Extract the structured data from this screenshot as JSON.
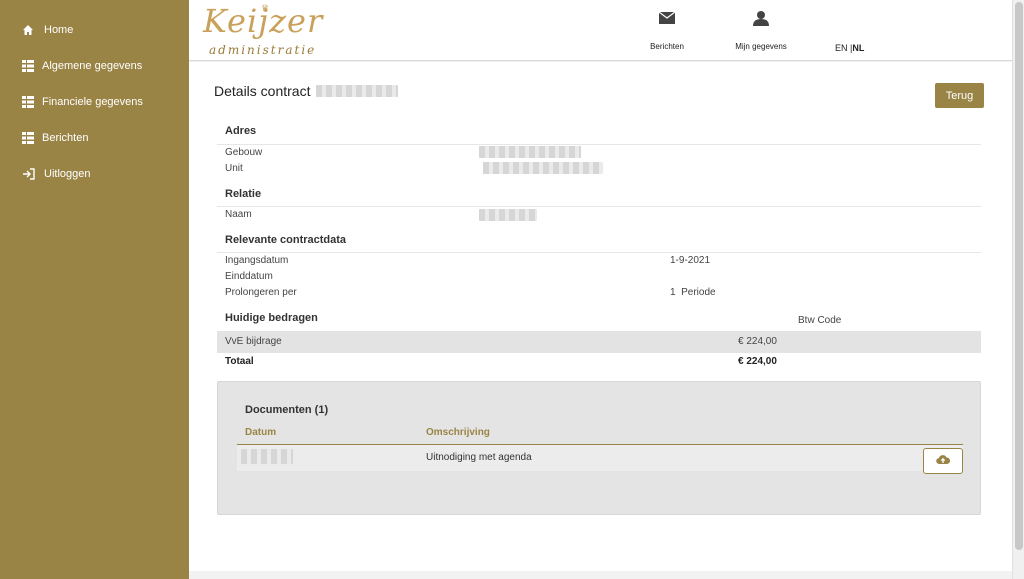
{
  "sidebar": {
    "items": [
      {
        "label": "Home",
        "icon": "home-icon"
      },
      {
        "label": "Algemene gegevens",
        "icon": "list-icon"
      },
      {
        "label": "Financiele gegevens",
        "icon": "list-icon"
      },
      {
        "label": "Berichten",
        "icon": "list-icon"
      },
      {
        "label": "Uitloggen",
        "icon": "logout-icon"
      }
    ]
  },
  "header": {
    "logo_main": "Keijzer",
    "logo_sub": "administratie",
    "messages_label": "Berichten",
    "profile_label": "Mijn gegevens",
    "lang_en": "EN",
    "lang_sep": " |",
    "lang_nl": "NL"
  },
  "page": {
    "title": "Details contract",
    "back_button": "Terug"
  },
  "sections": {
    "adres": {
      "title": "Adres",
      "gebouw_label": "Gebouw",
      "unit_label": "Unit"
    },
    "relatie": {
      "title": "Relatie",
      "naam_label": "Naam"
    },
    "contract": {
      "title": "Relevante contractdata",
      "ingangsdatum_label": "Ingangsdatum",
      "ingangsdatum_value": "1-9-2021",
      "einddatum_label": "Einddatum",
      "prolongeren_label": "Prolongeren per",
      "prolongeren_value": "1  Periode"
    },
    "bedragen": {
      "title": "Huidige bedragen",
      "btw_header": "Btw Code",
      "vve_label": "VvE bijdrage",
      "vve_value": "€ 224,00",
      "totaal_label": "Totaal",
      "totaal_value": "€ 224,00"
    }
  },
  "documents": {
    "title": "Documenten (1)",
    "col_datum": "Datum",
    "col_omschrijving": "Omschrijving",
    "rows": [
      {
        "omschrijving": "Uitnodiging met agenda"
      }
    ]
  },
  "colors": {
    "accent": "#9a8445",
    "logo": "#c9a15a"
  }
}
